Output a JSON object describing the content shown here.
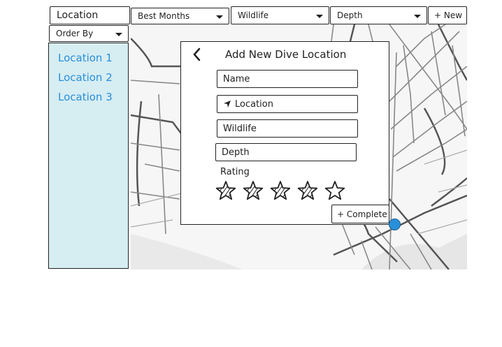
{
  "filters": {
    "location_label": "Location",
    "months_label": "Best Months",
    "wildlife_label": "Wildlife",
    "depth_label": "Depth",
    "new_label": "+ New"
  },
  "sidebar": {
    "order_by_label": "Order By",
    "items": [
      {
        "label": "Location 1"
      },
      {
        "label": "Location 2"
      },
      {
        "label": "Location 3"
      }
    ]
  },
  "modal": {
    "title": "Add New Dive Location",
    "name_placeholder": "Name",
    "location_placeholder": "Location",
    "wildlife_placeholder": "Wildlife",
    "depth_placeholder": "Depth",
    "rating_label": "Rating",
    "rating": 4,
    "rating_max": 5,
    "complete_label": "+ Complete"
  },
  "colors": {
    "sidebar_bg": "#d6edf2",
    "link": "#2a8fd9",
    "marker": "#2a8fd9"
  }
}
